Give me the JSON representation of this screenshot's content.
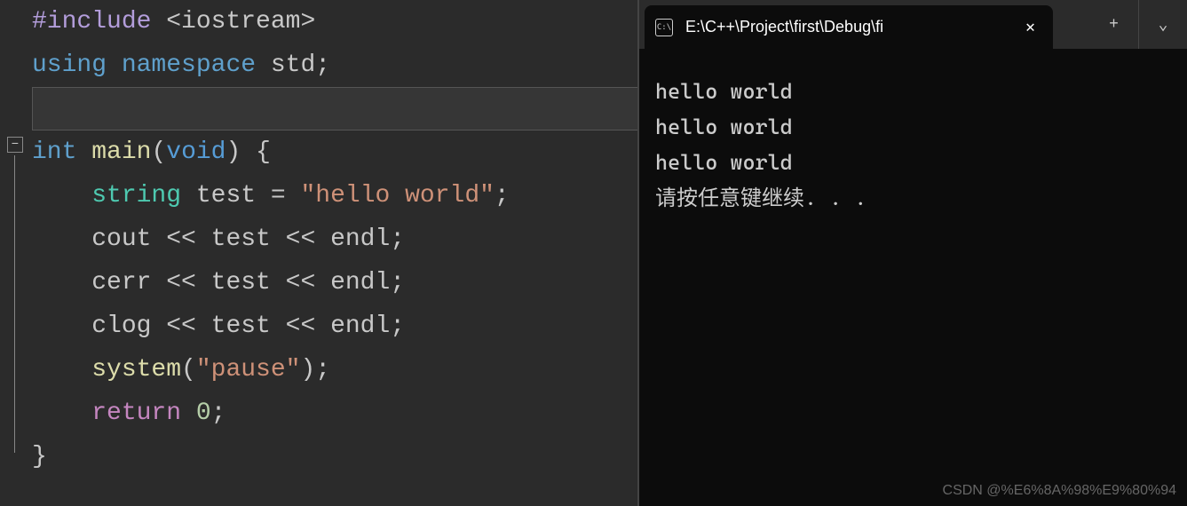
{
  "editor": {
    "fold_symbol": "−",
    "code_lines": [
      {
        "tokens": [
          {
            "cls": "tok-preproc",
            "t": "#include"
          },
          {
            "cls": "tok-op",
            "t": " "
          },
          {
            "cls": "tok-punct",
            "t": "<"
          },
          {
            "cls": "tok-ident",
            "t": "iostream"
          },
          {
            "cls": "tok-punct",
            "t": ">"
          }
        ]
      },
      {
        "tokens": [
          {
            "cls": "tok-keyword",
            "t": "using"
          },
          {
            "cls": "tok-op",
            "t": " "
          },
          {
            "cls": "tok-keyword",
            "t": "namespace"
          },
          {
            "cls": "tok-op",
            "t": " "
          },
          {
            "cls": "tok-ident",
            "t": "std"
          },
          {
            "cls": "tok-punct",
            "t": ";"
          }
        ]
      },
      {
        "highlight": true,
        "tokens": []
      },
      {
        "tokens": [
          {
            "cls": "tok-type",
            "t": "int"
          },
          {
            "cls": "tok-op",
            "t": " "
          },
          {
            "cls": "tok-funcname",
            "t": "main"
          },
          {
            "cls": "tok-punct",
            "t": "("
          },
          {
            "cls": "tok-void",
            "t": "void"
          },
          {
            "cls": "tok-punct",
            "t": ")"
          },
          {
            "cls": "tok-op",
            "t": " "
          },
          {
            "cls": "tok-punct",
            "t": "{"
          }
        ]
      },
      {
        "indent": true,
        "tokens": [
          {
            "cls": "tok-typename",
            "t": "    string"
          },
          {
            "cls": "tok-op",
            "t": " "
          },
          {
            "cls": "tok-ident",
            "t": "test"
          },
          {
            "cls": "tok-op",
            "t": " = "
          },
          {
            "cls": "tok-string",
            "t": "\"hello world\""
          },
          {
            "cls": "tok-punct",
            "t": ";"
          }
        ]
      },
      {
        "indent": true,
        "tokens": [
          {
            "cls": "tok-ident",
            "t": "    cout"
          },
          {
            "cls": "tok-op",
            "t": " << "
          },
          {
            "cls": "tok-ident",
            "t": "test"
          },
          {
            "cls": "tok-op",
            "t": " << "
          },
          {
            "cls": "tok-ident",
            "t": "endl"
          },
          {
            "cls": "tok-punct",
            "t": ";"
          }
        ]
      },
      {
        "indent": true,
        "tokens": [
          {
            "cls": "tok-ident",
            "t": "    cerr"
          },
          {
            "cls": "tok-op",
            "t": " << "
          },
          {
            "cls": "tok-ident",
            "t": "test"
          },
          {
            "cls": "tok-op",
            "t": " << "
          },
          {
            "cls": "tok-ident",
            "t": "endl"
          },
          {
            "cls": "tok-punct",
            "t": ";"
          }
        ]
      },
      {
        "indent": true,
        "tokens": [
          {
            "cls": "tok-ident",
            "t": "    clog"
          },
          {
            "cls": "tok-op",
            "t": " << "
          },
          {
            "cls": "tok-ident",
            "t": "test"
          },
          {
            "cls": "tok-op",
            "t": " << "
          },
          {
            "cls": "tok-ident",
            "t": "endl"
          },
          {
            "cls": "tok-punct",
            "t": ";"
          }
        ]
      },
      {
        "indent": true,
        "tokens": [
          {
            "cls": "tok-funcname",
            "t": "    system"
          },
          {
            "cls": "tok-punct",
            "t": "("
          },
          {
            "cls": "tok-string",
            "t": "\"pause\""
          },
          {
            "cls": "tok-punct",
            "t": ")"
          },
          {
            "cls": "tok-punct",
            "t": ";"
          }
        ]
      },
      {
        "indent": true,
        "tokens": [
          {
            "cls": "tok-return",
            "t": "    return"
          },
          {
            "cls": "tok-op",
            "t": " "
          },
          {
            "cls": "tok-number",
            "t": "0"
          },
          {
            "cls": "tok-punct",
            "t": ";"
          }
        ]
      },
      {
        "tokens": [
          {
            "cls": "tok-punct",
            "t": "}"
          }
        ]
      }
    ]
  },
  "terminal": {
    "icon_text": "C:\\",
    "tab_title": "E:\\C++\\Project\\first\\Debug\\fi",
    "close_glyph": "✕",
    "add_glyph": "+",
    "dropdown_glyph": "⌄",
    "output": [
      "hello world",
      "hello world",
      "hello world",
      "请按任意键继续. . ."
    ]
  },
  "watermark": "CSDN @%E6%8A%98%E9%80%94"
}
